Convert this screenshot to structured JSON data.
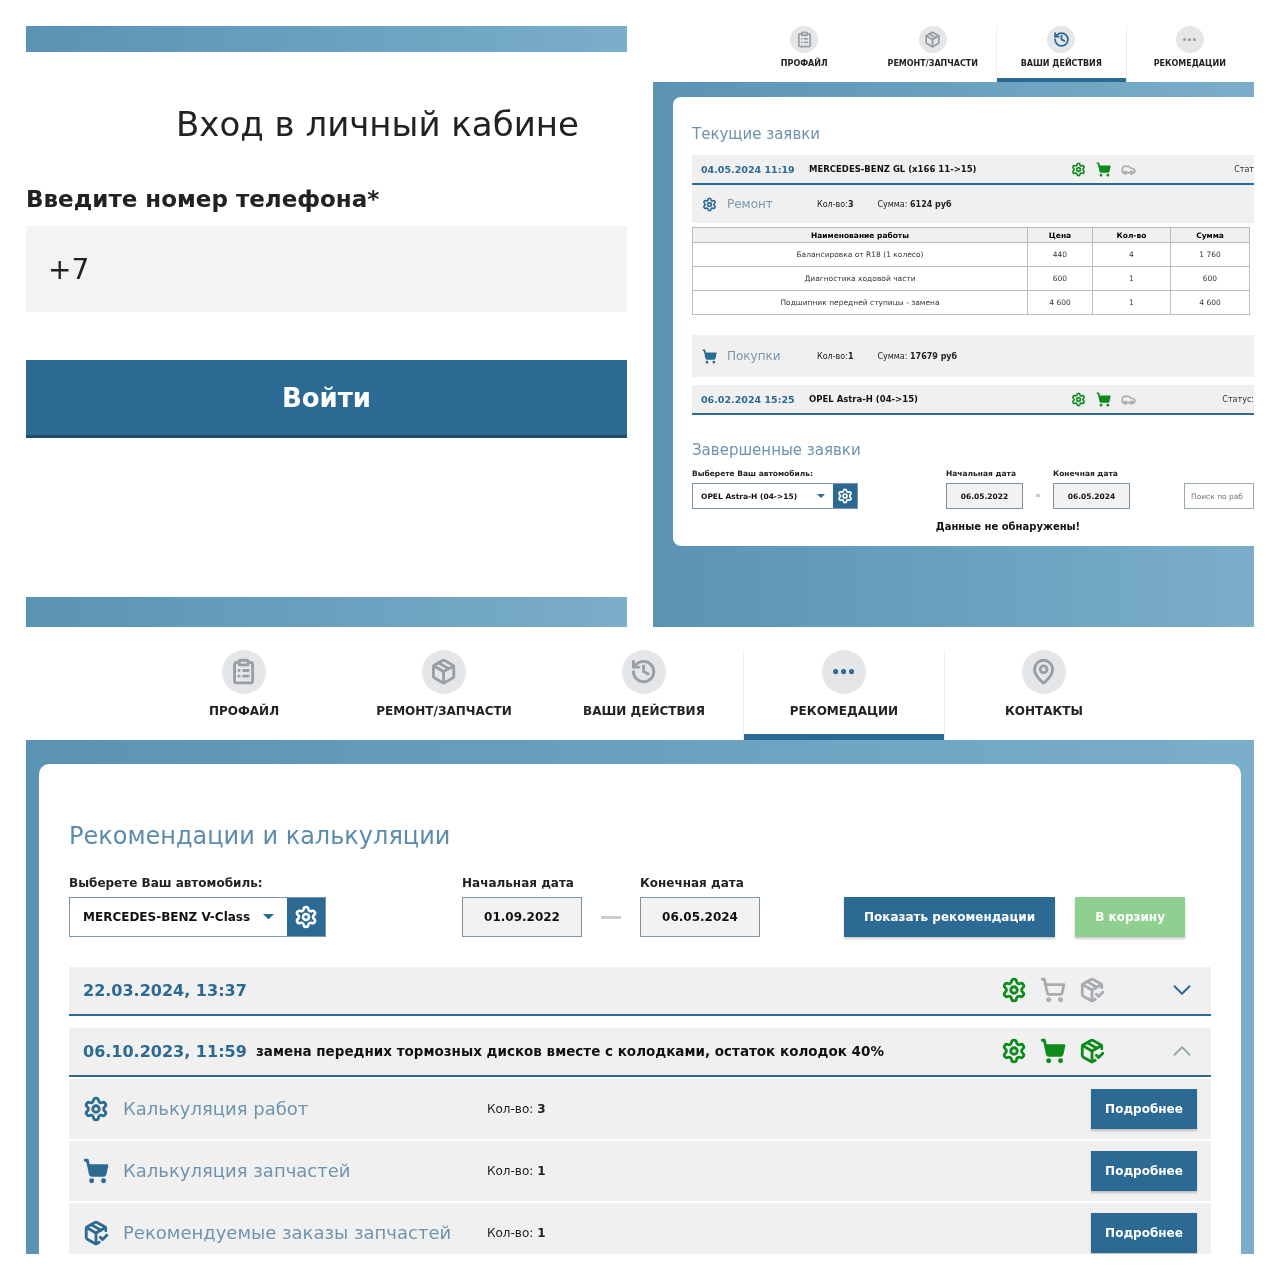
{
  "login": {
    "title": "Вход в личный кабине",
    "phone_label": "Введите номер телефона*",
    "phone_value": "+7",
    "submit": "Войти"
  },
  "actions_screen": {
    "tabs": [
      {
        "label": "ПРОФАЙЛ",
        "selected": false
      },
      {
        "label": "РЕМОНТ/ЗАПЧАСТИ",
        "selected": false
      },
      {
        "label": "ВАШИ ДЕЙСТВИЯ",
        "selected": true
      },
      {
        "label": "РЕКОМЕДАЦИИ",
        "selected": false
      }
    ],
    "current_title": "Текущие заявки",
    "orders": [
      {
        "date": "04.05.2024 11:19",
        "car": "MERCEDES-BENZ GL (x166 11->15)",
        "status": "Стат",
        "expanded": true,
        "icons": [
          {
            "kind": "repair",
            "active": true
          },
          {
            "kind": "cart",
            "active": true
          },
          {
            "kind": "lift",
            "active": false
          }
        ],
        "sections": [
          {
            "kind": "repair",
            "title": "Ремонт",
            "count_label": "Кол-во:",
            "count": "3",
            "sum_label": "Сумма:",
            "sum": "6124 руб",
            "table": {
              "columns": [
                "Наименование работы",
                "Цена",
                "Кол-во",
                "Сумма"
              ],
              "rows": [
                [
                  "Балансировка от R18 (1 колесо)",
                  "440",
                  "4",
                  "1 760"
                ],
                [
                  "Диагностика ходовой части",
                  "600",
                  "1",
                  "600"
                ],
                [
                  "Подшипник передней ступицы - замена",
                  "4 600",
                  "1",
                  "4 600"
                ]
              ]
            }
          },
          {
            "kind": "cart",
            "title": "Покупки",
            "count_label": "Кол-во:",
            "count": "1",
            "sum_label": "Сумма:",
            "sum": "17679 руб"
          }
        ]
      },
      {
        "date": "06.02.2024 15:25",
        "car": "OPEL Astra-H (04->15)",
        "status": "Статус:",
        "expanded": false,
        "icons": [
          {
            "kind": "repair",
            "active": true
          },
          {
            "kind": "cart",
            "active": true
          },
          {
            "kind": "lift",
            "active": false
          }
        ]
      }
    ],
    "done_title": "Завершенные заявки",
    "car_label": "Выберете Ваш автомобиль:",
    "car_value": "OPEL Astra-H (04->15)",
    "start_label": "Начальная дата",
    "start_value": "06.05.2022",
    "end_label": "Конечная дата",
    "end_value": "06.05.2024",
    "search": {
      "placeholder": "Поиск по раб"
    },
    "empty_message": "Данные не обнаружены!"
  },
  "recommendations_screen": {
    "tabs": [
      {
        "label": "ПРОФАЙЛ",
        "selected": false
      },
      {
        "label": "РЕМОНТ/ЗАПЧАСТИ",
        "selected": false
      },
      {
        "label": "ВАШИ ДЕЙСТВИЯ",
        "selected": false
      },
      {
        "label": "РЕКОМЕДАЦИИ",
        "selected": true
      },
      {
        "label": "КОНТАКТЫ",
        "selected": false
      }
    ],
    "title": "Рекомендации и калькуляции",
    "car_label": "Выберете Ваш автомобиль:",
    "car_value": "MERCEDES-BENZ V-Class",
    "start_label": "Начальная дата",
    "start_value": "01.09.2022",
    "end_label": "Конечная дата",
    "end_value": "06.05.2024",
    "buttons": [
      {
        "label": "Показать рекомендации",
        "kind": "primary",
        "disabled": false
      },
      {
        "label": "В корзину",
        "kind": "success",
        "disabled": true
      }
    ],
    "records": [
      {
        "date": "22.03.2024, 13:37",
        "expanded": false,
        "icons": [
          {
            "kind": "repair",
            "active": true
          },
          {
            "kind": "cart",
            "active": false
          },
          {
            "kind": "parcel",
            "active": false
          }
        ]
      },
      {
        "date": "06.10.2023, 11:59",
        "description": "замена передних тормозных дисков вместе с колодками, остаток колодок 40%",
        "expanded": true,
        "icons": [
          {
            "kind": "repair",
            "active": true
          },
          {
            "kind": "cart",
            "active": true
          },
          {
            "kind": "parcel",
            "active": true
          }
        ],
        "items": [
          {
            "kind": "repair",
            "title": "Калькуляция работ",
            "count_label": "Кол-во:",
            "count": "3",
            "action": "Подробнее"
          },
          {
            "kind": "cart",
            "title": "Калькуляция запчастей",
            "count_label": "Кол-во:",
            "count": "1",
            "action": "Подробнее"
          },
          {
            "kind": "parcel",
            "title": "Рекомендуемые заказы запчастей",
            "count_label": "Кол-во:",
            "count": "1",
            "action": "Подробнее"
          }
        ]
      }
    ]
  }
}
